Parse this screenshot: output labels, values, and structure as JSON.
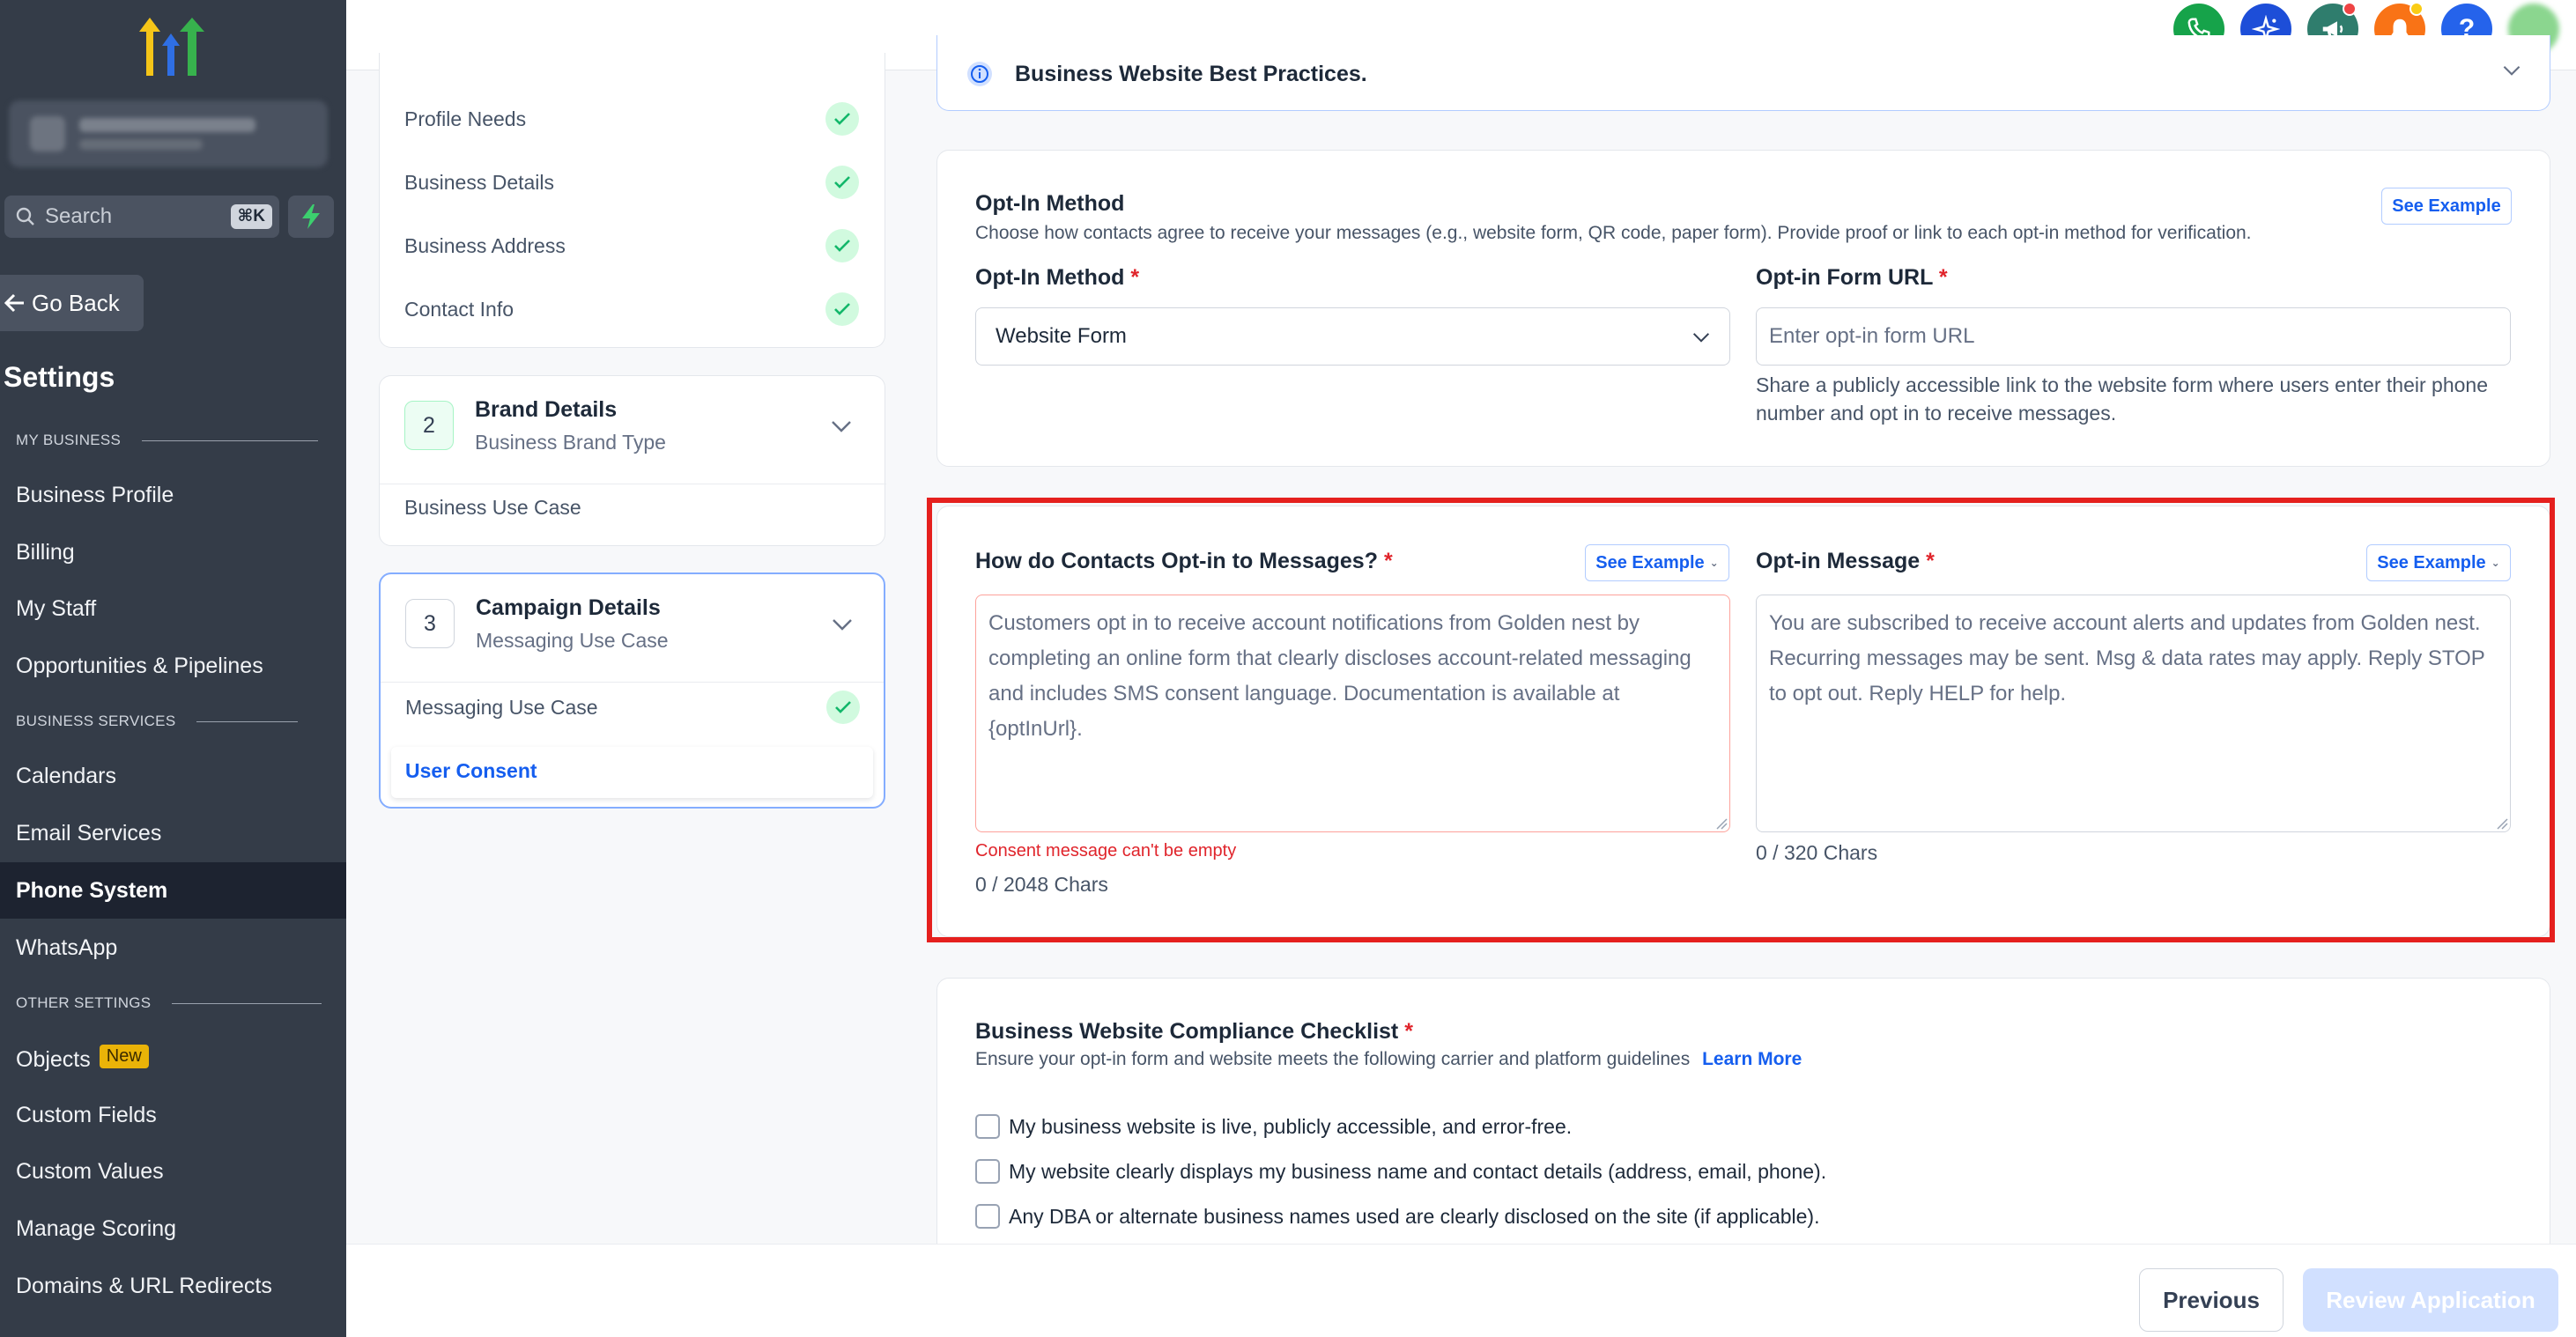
{
  "sidebar": {
    "search_placeholder": "Search",
    "search_shortcut": "⌘K",
    "go_back": "Go Back",
    "settings_title": "Settings",
    "sections": {
      "my_business": "MY BUSINESS",
      "business_services": "BUSINESS SERVICES",
      "other_settings": "OTHER SETTINGS"
    },
    "my_business_items": [
      "Business Profile",
      "Billing",
      "My Staff",
      "Opportunities & Pipelines"
    ],
    "business_services_items": [
      "Calendars",
      "Email Services",
      "Phone System",
      "WhatsApp"
    ],
    "active_item": "Phone System",
    "other_settings_items": [
      "Objects",
      "Custom Fields",
      "Custom Values",
      "Manage Scoring",
      "Domains & URL Redirects"
    ],
    "objects_badge": "New"
  },
  "topbar": {
    "icons": [
      "phone-icon",
      "sparkle-icon",
      "megaphone-icon",
      "bell-icon",
      "help-icon",
      "avatar"
    ],
    "colors": {
      "phone": "#16a34a",
      "sparkle": "#1d4ed8",
      "megaphone": "#2f7d6d",
      "bell": "#f97316",
      "help": "#2563eb"
    }
  },
  "stepper": {
    "step1_items": [
      "Profile Needs",
      "Business Details",
      "Business Address",
      "Contact Info"
    ],
    "step2": {
      "number": "2",
      "title": "Brand Details",
      "subtitle": "Business Brand Type",
      "items": [
        "Business Use Case"
      ]
    },
    "step3": {
      "number": "3",
      "title": "Campaign Details",
      "subtitle": "Messaging Use Case",
      "items": [
        "Messaging Use Case",
        "User Consent"
      ]
    }
  },
  "banner": {
    "title": "Business Website Best Practices."
  },
  "optin_method": {
    "title": "Opt-In Method",
    "description": "Choose how contacts agree to receive your messages (e.g., website form, QR code, paper form). Provide proof or link to each opt-in method for verification.",
    "see_example": "See Example",
    "method_label": "Opt-In Method",
    "method_value": "Website Form",
    "url_label": "Opt-in Form URL",
    "url_placeholder": "Enter opt-in form URL",
    "url_help": "Share a publicly accessible link to the website form where users enter their phone number and opt in to receive messages."
  },
  "consent": {
    "how_label": "How do Contacts Opt-in to Messages?",
    "how_see_example": "See Example",
    "how_placeholder": "Customers opt in to receive account notifications from Golden nest by completing an online form that clearly discloses account-related messaging and includes SMS consent language. Documentation is available at {optInUrl}.",
    "how_error": "Consent message can't be empty",
    "how_chars": "0 / 2048 Chars",
    "message_label": "Opt-in Message",
    "message_see_example": "See Example",
    "message_placeholder": "You are subscribed to receive account alerts and updates from Golden nest. Recurring messages may be sent. Msg & data rates may apply. Reply STOP to opt out. Reply HELP for help.",
    "message_chars": "0 / 320 Chars"
  },
  "checklist": {
    "title": "Business Website Compliance Checklist",
    "description": "Ensure your opt-in form and website meets the following carrier and platform guidelines",
    "learn_more": "Learn More",
    "items": [
      "My business website is live, publicly accessible, and error-free.",
      "My website clearly displays my business name and contact details (address, email, phone).",
      "Any DBA or alternate business names used are clearly disclosed on the site (if applicable)."
    ]
  },
  "footer": {
    "previous": "Previous",
    "review": "Review Application"
  }
}
